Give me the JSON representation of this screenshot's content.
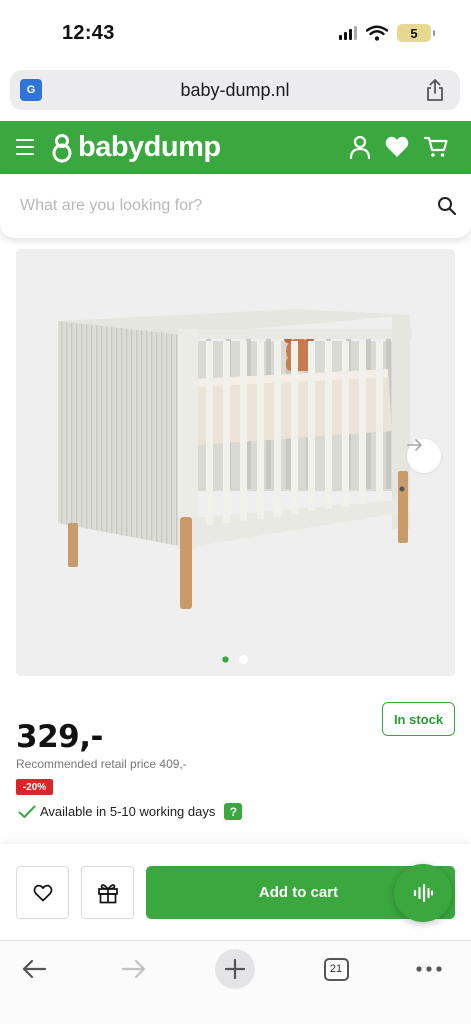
{
  "status_bar": {
    "time": "12:43",
    "battery": "5",
    "icons": [
      "signal-icon",
      "wifi-icon",
      "battery-icon"
    ]
  },
  "browser": {
    "url": "baby-dump.nl",
    "open_tabs": "21",
    "icons": [
      "translate-icon",
      "share-icon",
      "back-arrow-icon",
      "forward-arrow-icon",
      "new-tab-plus-icon",
      "tabs-icon",
      "more-dots-icon"
    ]
  },
  "site": {
    "logo_text": "babydump",
    "brand_color": "#3aa83f",
    "header_icons": [
      "hamburger-menu-icon",
      "pacifier-logo-icon",
      "account-icon",
      "wishlist-heart-icon",
      "cart-icon"
    ]
  },
  "search": {
    "placeholder": "What are you looking for?",
    "value": ""
  },
  "gallery": {
    "image_subject": "white crib with wooden legs",
    "slide_count": 2,
    "active_slide": 1
  },
  "product": {
    "stock_status": "In stock",
    "price": "329,-",
    "rrp_text": "Recommended retail price 409,-",
    "discount": "-20%",
    "availability": "Available in 5-10 working days",
    "help_label": "?",
    "discount_color": "#d62828"
  },
  "actions": {
    "add_to_cart": "Add to cart",
    "icons": [
      "wishlist-heart-icon",
      "gift-icon",
      "voice-assistant-icon"
    ]
  }
}
